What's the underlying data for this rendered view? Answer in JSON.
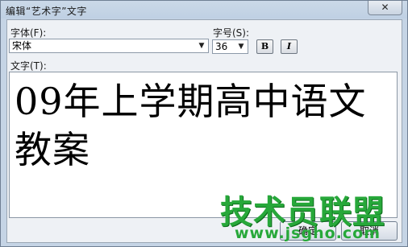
{
  "window": {
    "title": "编辑“艺术字”文字",
    "close_label": "✕"
  },
  "font": {
    "label": "字体(F):",
    "value": "宋体"
  },
  "size": {
    "label": "字号(S):",
    "value": "36"
  },
  "format": {
    "bold_label": "B",
    "italic_label": "I"
  },
  "text": {
    "label": "文字(T):",
    "content": "09年上学期高中语文教案"
  },
  "buttons": {
    "ok_label": "确定",
    "cancel_label": "取消"
  },
  "watermark": {
    "text": "技术员联盟",
    "url": "www.jsgho.com"
  },
  "icons": {
    "dropdown": "chevron-down-icon",
    "close": "close-icon"
  },
  "colors": {
    "titlebar": "#c2d3e6",
    "watermark": "#27a83a"
  }
}
